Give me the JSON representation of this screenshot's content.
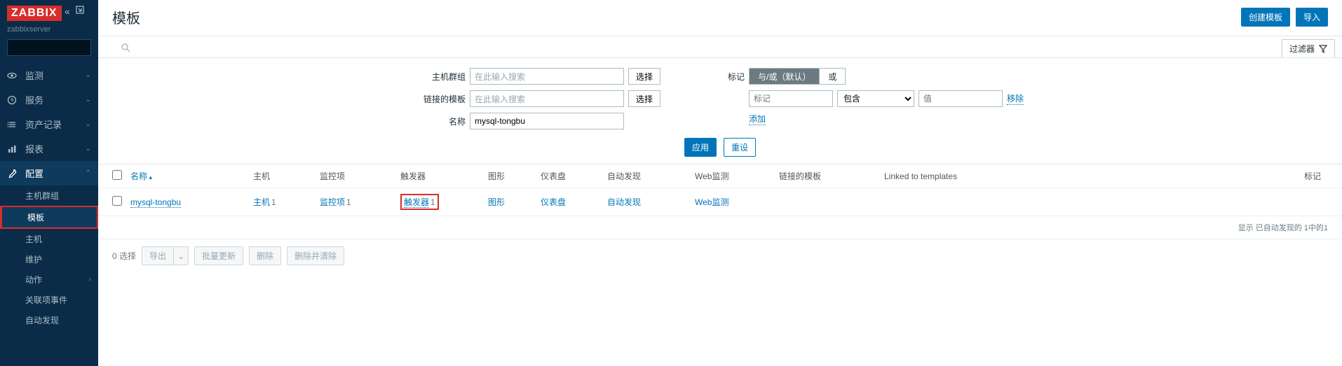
{
  "brand": "ZABBIX",
  "server_name": "zabbixserver",
  "search_placeholder": "",
  "nav": {
    "monitor": "监测",
    "service": "服务",
    "inventory": "资产记录",
    "reports": "报表",
    "config": "配置"
  },
  "config_sub": {
    "hostgroups": "主机群组",
    "templates": "模板",
    "hosts": "主机",
    "maintenance": "维护",
    "actions": "动作",
    "correlation": "关联项事件",
    "discovery": "自动发现"
  },
  "page_title": "模板",
  "buttons": {
    "create": "创建模板",
    "import": "导入",
    "filter": "过滤器",
    "select": "选择",
    "apply": "应用",
    "reset": "重设",
    "add": "添加",
    "remove": "移除",
    "export": "导出",
    "massupdate": "批量更新",
    "delete": "删除",
    "deleteclear": "删除并清除"
  },
  "filter": {
    "label_hostgroups": "主机群组",
    "label_linked": "链接的模板",
    "label_name": "名称",
    "placeholder_search": "在此输入搜索",
    "name_value": "mysql-tongbu",
    "label_tags": "标记",
    "seg_andor": "与/或（默认）",
    "seg_or": "或",
    "tag_placeholder": "标记",
    "op_contains": "包含",
    "val_placeholder": "值"
  },
  "columns": {
    "name": "名称",
    "host": "主机",
    "items": "监控项",
    "triggers": "触发器",
    "graphs": "图形",
    "dashboards": "仪表盘",
    "discovery": "自动发现",
    "web": "Web监测",
    "linked_tpl": "链接的模板",
    "linked_to": "Linked to templates",
    "tags": "标记"
  },
  "rows": [
    {
      "name": "mysql-tongbu",
      "host_label": "主机",
      "host_count": "1",
      "items_label": "监控项",
      "items_count": "1",
      "triggers_label": "触发器",
      "triggers_count": "1",
      "graphs_label": "图形",
      "dash_label": "仪表盘",
      "disc_label": "自动发现",
      "web_label": "Web监测"
    }
  ],
  "footer_text": "显示 已自动发现的 1中的1",
  "selected_text": "0 选择"
}
